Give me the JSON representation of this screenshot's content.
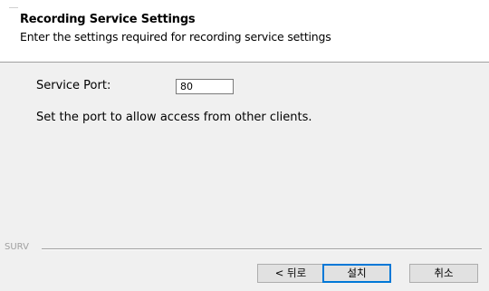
{
  "header": {
    "title": "Recording Service Settings",
    "subtitle": "Enter the settings required for recording service settings"
  },
  "form": {
    "port_label": "Service Port:",
    "port_value": "80",
    "help_text": "Set the port to allow access from other clients."
  },
  "footer": {
    "brand": "SURV"
  },
  "buttons": {
    "back": "< 뒤로",
    "install": "설치",
    "cancel": "취소"
  },
  "colors": {
    "background": "#f0f0f0",
    "header_background": "#ffffff",
    "default_button_border": "#0078d7"
  }
}
